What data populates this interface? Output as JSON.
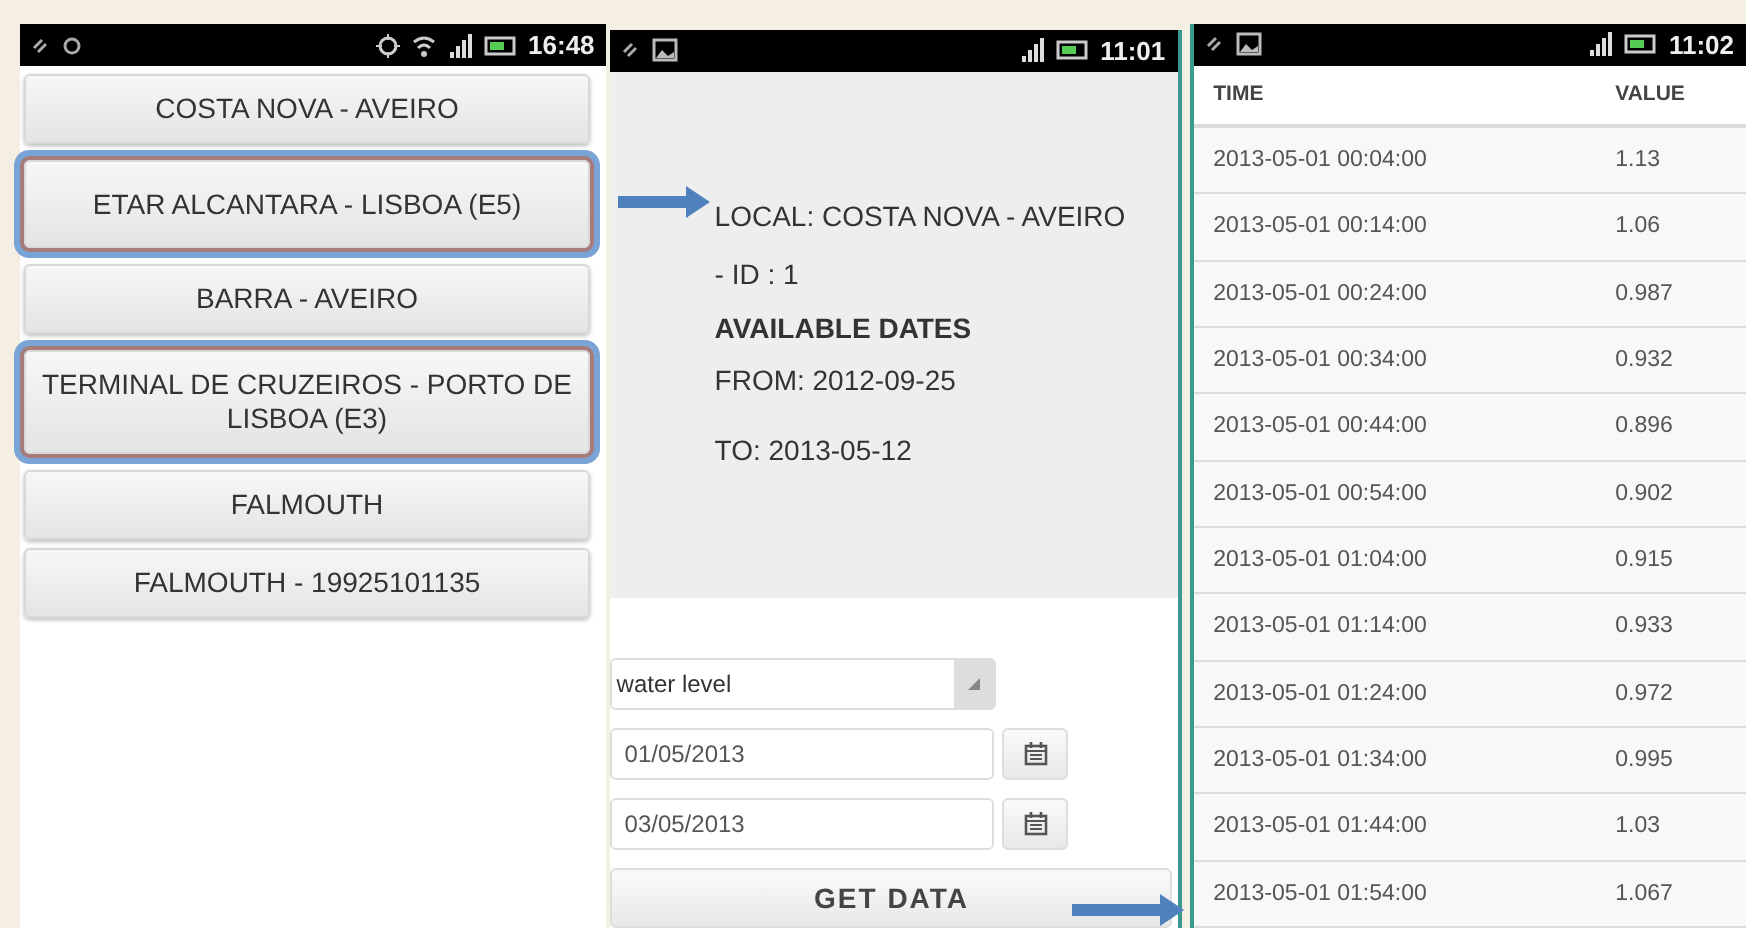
{
  "screens": [
    {
      "kind": "list",
      "status_bar": {
        "time": "16:48"
      },
      "items": [
        {
          "label": "COSTA NOVA - AVEIRO",
          "highlighted": false
        },
        {
          "label": "ETAR ALCANTARA - LISBOA (E5)",
          "highlighted": true
        },
        {
          "label": "BARRA - AVEIRO",
          "highlighted": false
        },
        {
          "label": "TERMINAL DE CRUZEIROS - PORTO DE LISBOA (E3)",
          "highlighted": true
        },
        {
          "label": "FALMOUTH",
          "highlighted": false
        },
        {
          "label": "FALMOUTH - 19925101135",
          "highlighted": false
        }
      ]
    },
    {
      "kind": "detail",
      "status_bar": {
        "time": "11:01"
      },
      "local": "LOCAL: COSTA NOVA - AVEIRO - ID : 1",
      "heading": "AVAILABLE DATES",
      "from": "FROM: 2012-09-25",
      "to": "TO: 2013-05-12",
      "dropdown": {
        "value": "water level"
      },
      "date_fields": [
        {
          "value": "01/05/2013"
        },
        {
          "value": "03/05/2013"
        }
      ],
      "button": "GET DATA"
    },
    {
      "kind": "table",
      "status_bar": {
        "time": "11:02"
      },
      "columns": [
        "TIME",
        "VALUE"
      ],
      "rows": [
        [
          "2013-05-01 00:04:00",
          "1.13"
        ],
        [
          "2013-05-01 00:14:00",
          "1.06"
        ],
        [
          "2013-05-01 00:24:00",
          "0.987"
        ],
        [
          "2013-05-01 00:34:00",
          "0.932"
        ],
        [
          "2013-05-01 00:44:00",
          "0.896"
        ],
        [
          "2013-05-01 00:54:00",
          "0.902"
        ],
        [
          "2013-05-01 01:04:00",
          "0.915"
        ],
        [
          "2013-05-01 01:14:00",
          "0.933"
        ],
        [
          "2013-05-01 01:24:00",
          "0.972"
        ],
        [
          "2013-05-01 01:34:00",
          "0.995"
        ],
        [
          "2013-05-01 01:44:00",
          "1.03"
        ],
        [
          "2013-05-01 01:54:00",
          "1.067"
        ]
      ]
    }
  ]
}
